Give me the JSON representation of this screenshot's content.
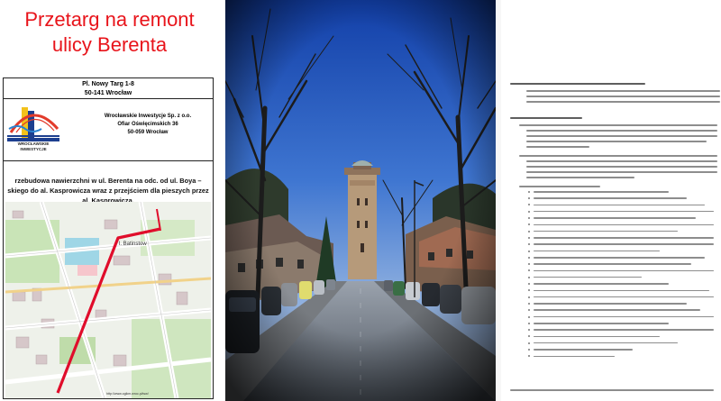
{
  "headline": {
    "line1": "Przetarg na remont",
    "line2": "ulicy Berenta",
    "color": "#e8141b"
  },
  "tender_document": {
    "address_line1": "Pl. Nowy Targ 1-8",
    "address_line2": "50-141 Wrocław",
    "logo_text_line1": "WROCŁAWSKIE",
    "logo_text_line2": "INWESTYCJE",
    "recipient_line1": "Wrocławskie Inwestycje Sp. z o.o.",
    "recipient_line2": "Ofiar Oświęcimskich 36",
    "recipient_line3": "50-059 Wrocław",
    "title_line1": "rzebudowa nawierzchni w ul. Berenta na odc. od ul. Boya –",
    "title_line2": "skiego do al. Kasprowicza wraz z przejściem dla pieszych przez",
    "title_line3": "al. Kasprowicza.",
    "map_street_label": "l. Batinstow",
    "map_url": "http://www.ogikm.wroc.pl/ww/"
  },
  "right_document": {
    "section_heading": "Ochrona konserwatorska i archeologiczna",
    "section2_heading": "Opis zamówienia"
  }
}
